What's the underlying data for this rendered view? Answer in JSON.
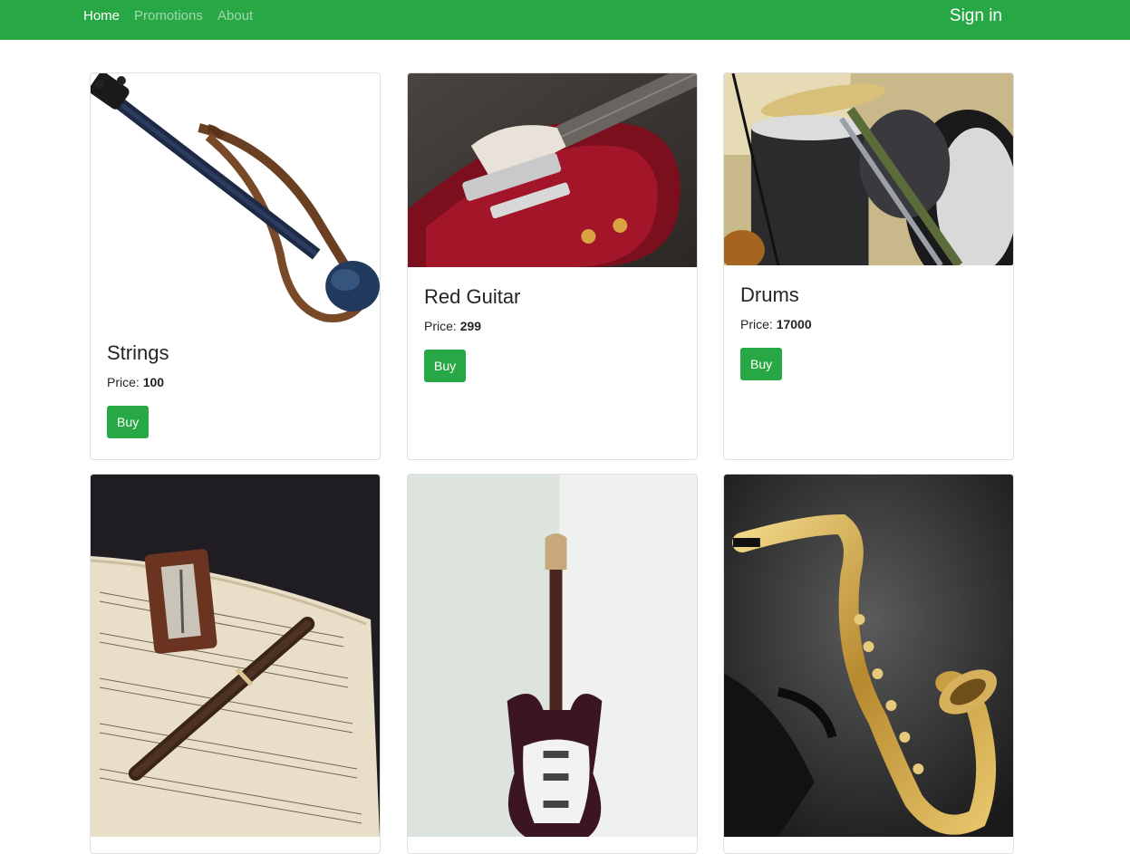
{
  "nav": {
    "links": [
      {
        "label": "Home",
        "active": true
      },
      {
        "label": "Promotions",
        "active": false
      },
      {
        "label": "About",
        "active": false
      }
    ],
    "signin_label": "Sign in"
  },
  "colors": {
    "primary": "#28a745",
    "nav_inactive": "rgba(255,255,255,0.55)"
  },
  "products": [
    {
      "name": "Strings",
      "price_label": "Price: ",
      "price": "100",
      "buy_label": "Buy",
      "image": "electric-violin-image"
    },
    {
      "name": "Red Guitar",
      "price_label": "Price: ",
      "price": "299",
      "buy_label": "Buy",
      "image": "red-guitar-image"
    },
    {
      "name": "Drums",
      "price_label": "Price: ",
      "price": "17000",
      "buy_label": "Buy",
      "image": "drum-kit-image"
    },
    {
      "name": "",
      "image": "recorder-metronome-image"
    },
    {
      "name": "",
      "image": "electric-guitar-corner-image"
    },
    {
      "name": "",
      "image": "saxophone-image"
    }
  ]
}
